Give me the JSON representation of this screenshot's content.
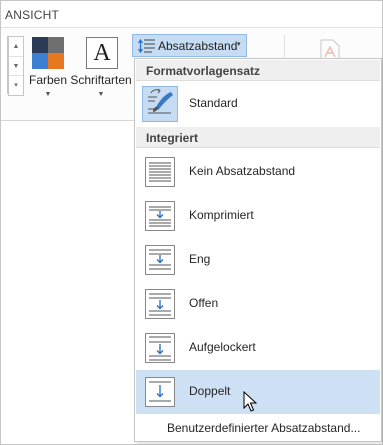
{
  "tab": {
    "label": "ANSICHT"
  },
  "ribbon": {
    "farben": {
      "label": "Farben",
      "colors": [
        "#2b3a55",
        "#6e6e6e",
        "#3d7fd1",
        "#e87722"
      ]
    },
    "schriftarten": {
      "label": "Schriftarten",
      "glyph": "A"
    },
    "absatzabstand": {
      "label": "Absatzabstand",
      "icon": "paragraph-spacing-icon"
    },
    "accent": "#c5dcf3"
  },
  "menu": {
    "sections": [
      {
        "title": "Formatvorlagensatz"
      },
      {
        "title": "Integriert"
      }
    ],
    "standard": {
      "label": "Standard",
      "icon": "style-set-brush-icon"
    },
    "items": [
      {
        "label": "Kein Absatzabstand"
      },
      {
        "label": "Komprimiert"
      },
      {
        "label": "Eng"
      },
      {
        "label": "Offen"
      },
      {
        "label": "Aufgelockert"
      },
      {
        "label": "Doppelt"
      }
    ],
    "footer": "Benutzerdefinierter Absatzabstand...",
    "hover_color": "#cde0f4"
  }
}
